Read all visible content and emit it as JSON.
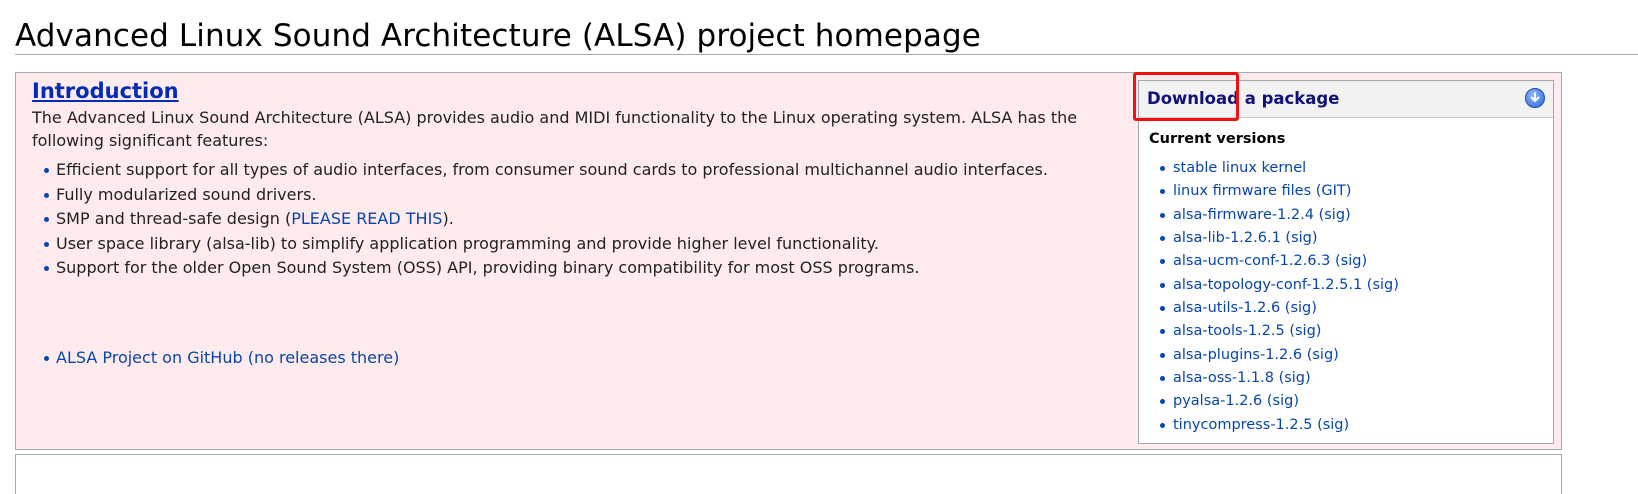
{
  "page": {
    "title": "Advanced Linux Sound Architecture (ALSA) project homepage"
  },
  "intro": {
    "heading": "Introduction",
    "text": "The Advanced Linux Sound Architecture (ALSA) provides audio and MIDI functionality to the Linux operating system. ALSA has the following significant features:",
    "features": [
      "Efficient support for all types of audio interfaces, from consumer sound cards to professional multichannel audio interfaces.",
      "Fully modularized sound drivers.",
      "SMP and thread-safe design (",
      "User space library (alsa-lib) to simplify application programming and provide higher level functionality.",
      "Support for the older Open Sound System (OSS) API, providing binary compatibility for most OSS programs."
    ],
    "smp_link": "PLEASE READ THIS",
    "smp_suffix": ").",
    "github_link": "ALSA Project on GitHub (no releases there)"
  },
  "download": {
    "title": "Download a package",
    "icon": "download-arrow-icon",
    "current_label": "Current versions",
    "packages": [
      "stable linux kernel",
      "linux firmware files (GIT)",
      "alsa-firmware-1.2.4 (sig)",
      "alsa-lib-1.2.6.1 (sig)",
      "alsa-ucm-conf-1.2.6.3 (sig)",
      "alsa-topology-conf-1.2.5.1 (sig)",
      "alsa-utils-1.2.6 (sig)",
      "alsa-tools-1.2.5 (sig)",
      "alsa-plugins-1.2.6 (sig)",
      "alsa-oss-1.1.8 (sig)",
      "pyalsa-1.2.6 (sig)",
      "tinycompress-1.2.5 (sig)"
    ]
  },
  "colors": {
    "link": "#0645ad",
    "intro_background": "#ffeaee",
    "highlight": "#ee1111",
    "panel_title": "#10127a"
  }
}
